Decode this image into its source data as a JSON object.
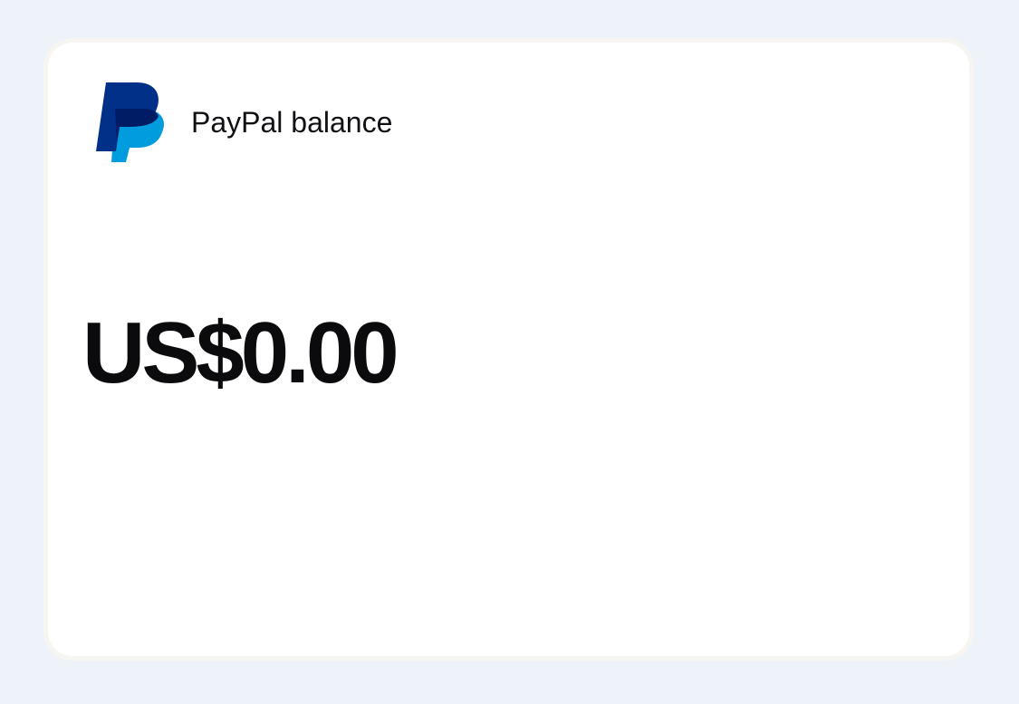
{
  "balance_card": {
    "title": "PayPal balance",
    "amount": "US$0.00",
    "logo_icon": "paypal-logo-icon"
  },
  "colors": {
    "page_background": "#eef2f9",
    "card_background": "#ffffff",
    "card_border": "#f6f5f1",
    "logo_dark_blue": "#003087",
    "logo_mid_blue": "#001c64",
    "logo_light_blue": "#009cde",
    "text": "#0b0b0d"
  }
}
